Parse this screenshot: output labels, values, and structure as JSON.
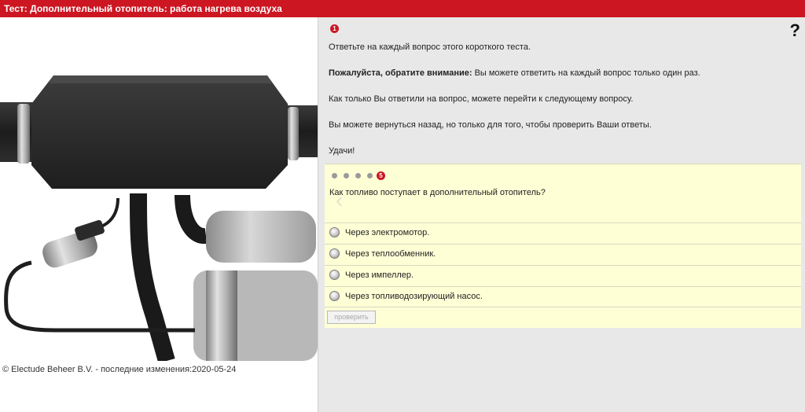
{
  "window": {
    "title": "Тест: Дополнительный отопитель: работа нагрева воздуха"
  },
  "footer": {
    "copyright": "© Electude Beheer B.V. - последние изменения:2020-05-24"
  },
  "instructions": {
    "step_number": "1",
    "line1": "Ответьте на каждый вопрос этого короткого теста.",
    "attention_bold": "Пожалуйста, обратите внимание:",
    "attention_text": " Вы можете ответить на каждый вопрос только один раз.",
    "line3": "Как только Вы ответили на вопрос, можете перейти к следующему вопросу.",
    "line4": "Вы можете вернуться назад, но только для того, чтобы проверить Ваши ответы.",
    "line5": "Удачи!"
  },
  "help": {
    "icon": "question-mark-icon",
    "label": "?"
  },
  "quiz": {
    "current_question": "5",
    "total_dots_before": 4,
    "question": "Как топливо поступает в дополнительный отопитель?",
    "answers": [
      "Через электромотор.",
      "Через теплообменник.",
      "Через импеллер.",
      "Через топливодозирующий насос."
    ],
    "check_button": "проверить"
  },
  "colors": {
    "accent": "#cc1622",
    "quiz_bg": "#ffffd6",
    "pane_bg": "#e8e8e8"
  }
}
